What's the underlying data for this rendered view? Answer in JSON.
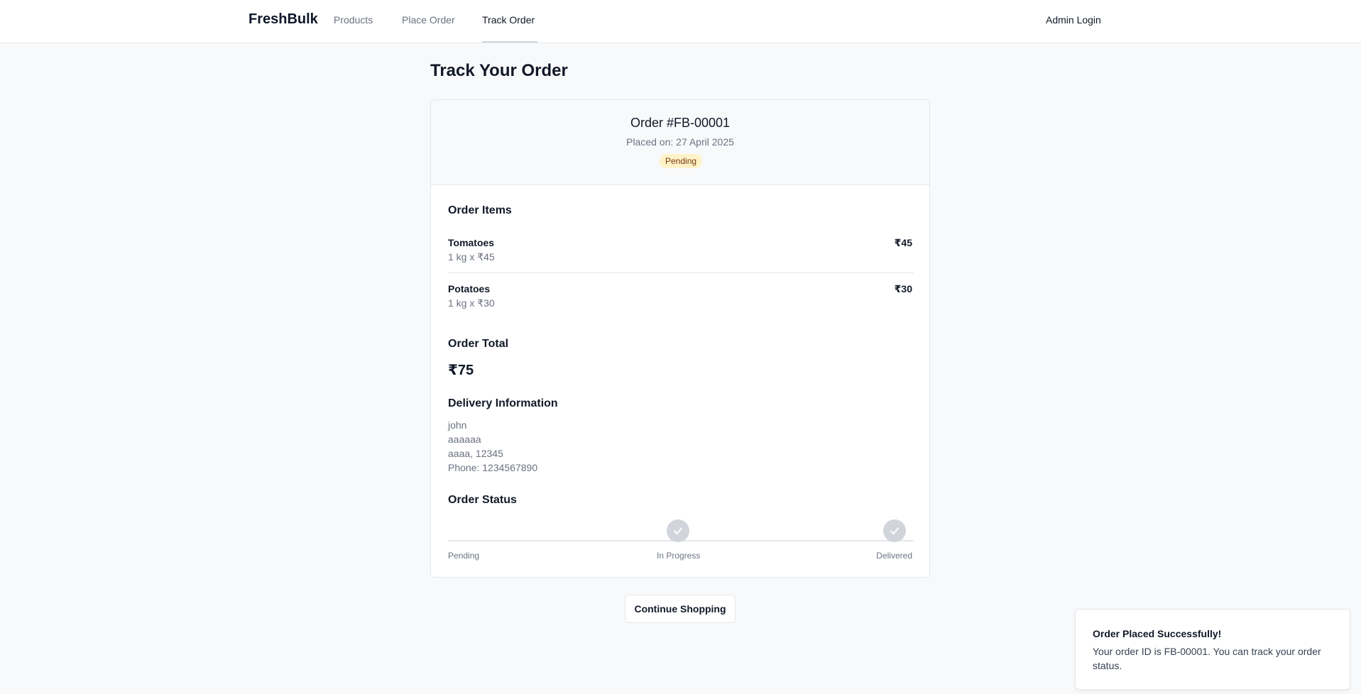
{
  "nav": {
    "brand": "FreshBulk",
    "links": [
      "Products",
      "Place Order",
      "Track Order"
    ],
    "active": "Track Order",
    "admin_login": "Admin Login"
  },
  "page": {
    "title": "Track Your Order"
  },
  "order": {
    "id_label": "Order #FB-00001",
    "placed_on": "Placed on: 27 April 2025",
    "status_badge": "Pending",
    "colors": {
      "badge_bg": "#fef3c7",
      "badge_text": "#78350f"
    }
  },
  "items_section": {
    "title": "Order Items",
    "items": [
      {
        "name": "Tomatoes",
        "meta": "1 kg x ₹45",
        "price": "₹45"
      },
      {
        "name": "Potatoes",
        "meta": "1 kg x ₹30",
        "price": "₹30"
      }
    ]
  },
  "total_section": {
    "title": "Order Total",
    "value": "₹75"
  },
  "delivery_section": {
    "title": "Delivery Information",
    "lines": [
      "john",
      "aaaaaa",
      "aaaa, 12345",
      "Phone: 1234567890"
    ]
  },
  "status_section": {
    "title": "Order Status",
    "steps": [
      {
        "label": "Pending",
        "icon": "none"
      },
      {
        "label": "In Progress",
        "icon": "check-icon"
      },
      {
        "label": "Delivered",
        "icon": "check-icon"
      }
    ]
  },
  "continue_button": "Continue Shopping",
  "toast": {
    "title": "Order Placed Successfully!",
    "body": "Your order ID is FB-00001. You can track your order status."
  }
}
